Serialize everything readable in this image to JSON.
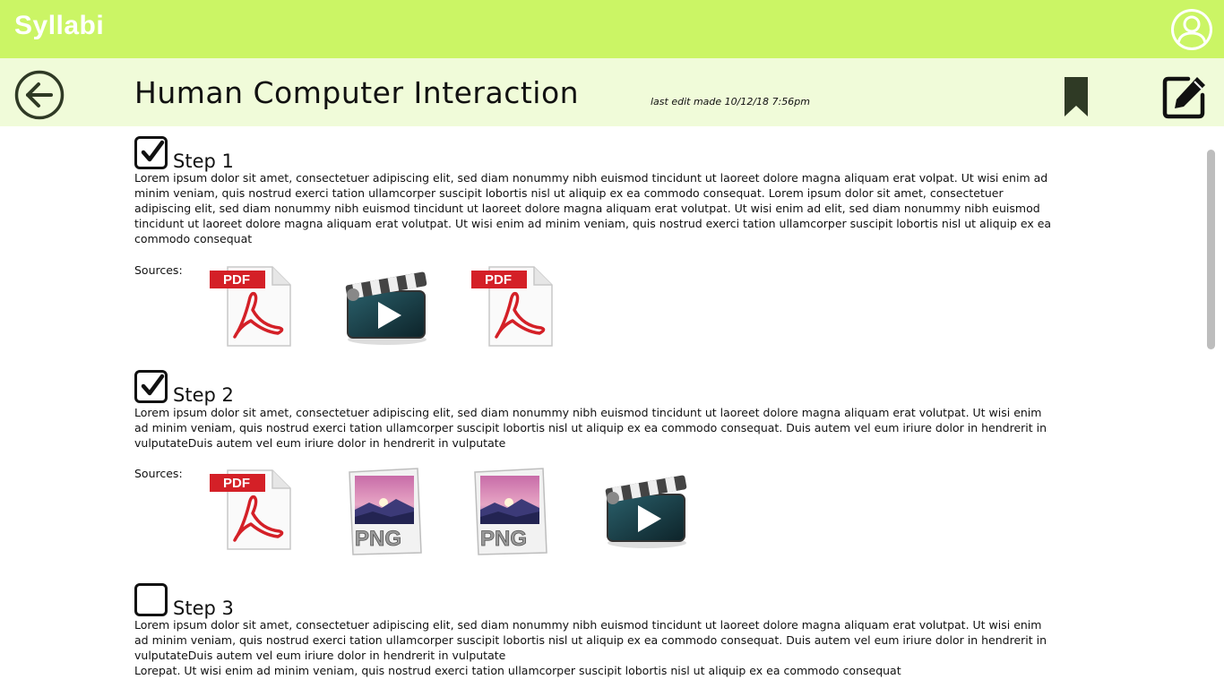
{
  "app": {
    "brand": "Syllabi"
  },
  "header": {
    "title": "Human Computer Interaction",
    "last_edit": "last edit made 10/12/18 7:56pm"
  },
  "colors": {
    "topbar": "#cbf565",
    "subbar": "#f0fbd9",
    "accent_dark": "#2f3a25"
  },
  "icons": {
    "avatar": "user-avatar-icon",
    "back": "arrow-left-circle-icon",
    "bookmark": "bookmark-icon",
    "edit": "edit-pencil-icon",
    "pdf": "pdf-file-icon",
    "video": "video-clapper-icon",
    "png": "png-image-icon"
  },
  "sources_label": "Sources:",
  "steps": [
    {
      "title": "Step 1",
      "checked": true,
      "body": "Lorem ipsum dolor sit amet, consectetuer adipiscing elit, sed diam nonummy nibh euismod tincidunt ut laoreet dolore magna aliquam erat volpat. Ut wisi enim ad minim veniam, quis nostrud exerci tation ullamcorper suscipit lobortis nisl ut aliquip ex ea commodo consequat. Lorem ipsum dolor sit amet, consectetuer adipiscing elit, sed diam nonummy nibh euismod tincidunt ut laoreet dolore magna aliquam erat volutpat. Ut wisi enim ad elit, sed diam nonummy nibh euismod tincidunt ut laoreet dolore magna aliquam erat volutpat. Ut wisi enim ad minim veniam, quis nostrud exerci tation ullamcorper suscipit lobortis nisl ut aliquip ex ea commodo consequat",
      "sources": [
        "pdf",
        "video",
        "pdf"
      ]
    },
    {
      "title": "Step 2",
      "checked": true,
      "body": "Lorem ipsum dolor sit amet, consectetuer adipiscing elit, sed diam nonummy nibh euismod tincidunt ut laoreet dolore magna aliquam erat volutpat. Ut wisi enim ad minim veniam, quis nostrud exerci tation ullamcorper suscipit lobortis nisl ut aliquip ex ea commodo consequat. Duis autem vel eum iriure dolor in hendrerit in vulputateDuis autem vel eum iriure dolor in hendrerit in vulputate",
      "sources": [
        "pdf",
        "png",
        "png",
        "video"
      ]
    },
    {
      "title": "Step 3",
      "checked": false,
      "body": "Lorem ipsum dolor sit amet, consectetuer adipiscing elit, sed diam nonummy nibh euismod tincidunt ut laoreet dolore magna aliquam erat volutpat. Ut wisi enim ad minim veniam, quis nostrud exerci tation ullamcorper suscipit lobortis nisl ut aliquip ex ea commodo consequat. Duis autem vel eum iriure dolor in hendrerit in vulputateDuis autem vel eum iriure dolor in hendrerit in vulputate",
      "body2": "Lorepat. Ut wisi enim ad minim veniam, quis nostrud exerci tation ullamcorper suscipit lobortis nisl ut aliquip ex ea commodo consequat",
      "sources": []
    }
  ]
}
